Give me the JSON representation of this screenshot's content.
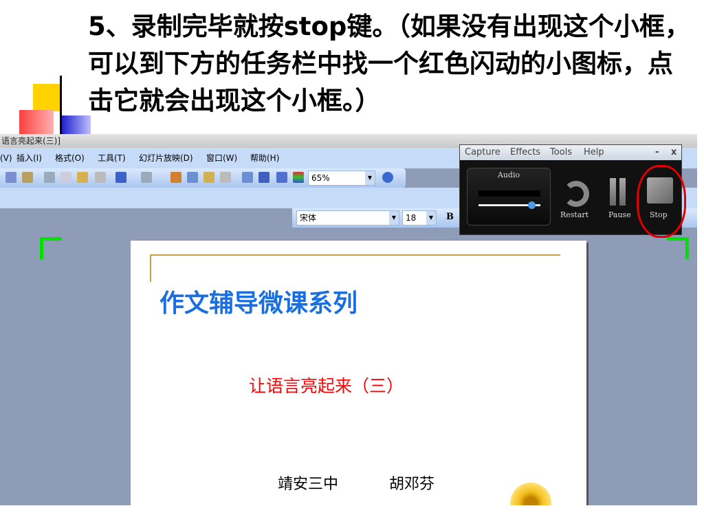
{
  "slide_heading": "5、录制完毕就按stop键。（如果没有出现这个小框，可以到下方的任务栏中找一个红色闪动的小图标，点击它就会出现这个小框。）",
  "app": {
    "window_title": "语言亮起来(三)]",
    "menu": [
      "(V)",
      "插入(I)",
      "格式(O)",
      "工具(T)",
      "幻灯片放映(D)",
      "窗口(W)",
      "帮助(H)"
    ],
    "zoom": "65%",
    "font_name": "宋体",
    "font_size": "18",
    "bold_label": "B"
  },
  "recorder": {
    "menu": [
      "Capture",
      "Effects",
      "Tools",
      "Help"
    ],
    "minimize": "-",
    "close": "x",
    "audio_label": "Audio",
    "audio_level": 0.85,
    "restart": "Restart",
    "pause": "Pause",
    "stop": "Stop",
    "highlight_color": "#e00000"
  },
  "slide": {
    "title": "作文辅导微课系列",
    "subtitle": "让语言亮起来（三）",
    "author_school": "靖安三中",
    "author_name": "胡邓芬",
    "title_color": "#1a6fe0",
    "subtitle_color": "#ff0000"
  }
}
